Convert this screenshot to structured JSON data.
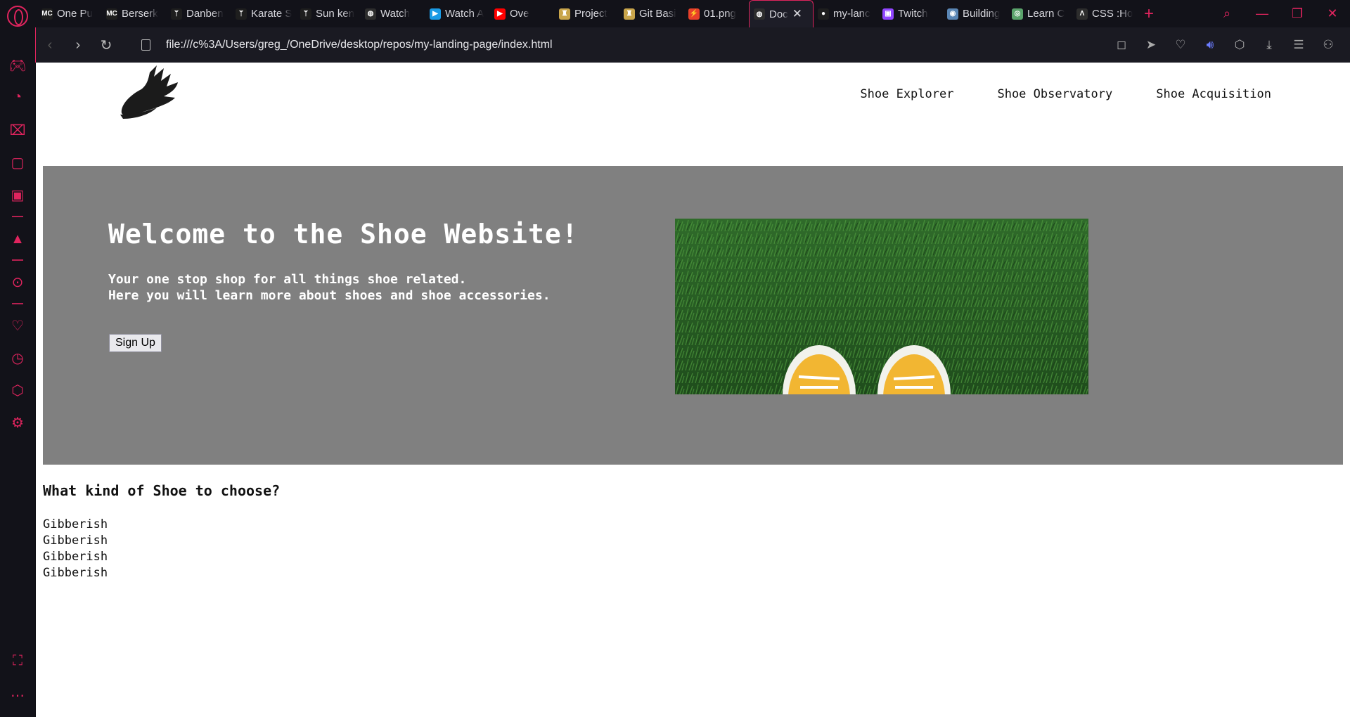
{
  "tabs": [
    {
      "title": "One Pu",
      "favicon": "mc-icon",
      "color": "#1e1e1e"
    },
    {
      "title": "Berserk",
      "favicon": "mc-icon",
      "color": "#1e1e1e"
    },
    {
      "title": "Danben",
      "favicon": "branch-icon",
      "color": "#1e1e1e"
    },
    {
      "title": "Karate S",
      "favicon": "branch-icon",
      "color": "#1e1e1e"
    },
    {
      "title": "Sun ken",
      "favicon": "branch-icon",
      "color": "#1e1e1e"
    },
    {
      "title": "Watch",
      "favicon": "globe-icon",
      "color": "#2d2d2d"
    },
    {
      "title": "Watch A",
      "favicon": "play-icon",
      "color": "#1a9be6"
    },
    {
      "title": "Ove",
      "favicon": "youtube-icon",
      "color": "#ff0000"
    },
    {
      "title": "Project",
      "favicon": "odin-icon",
      "color": "#c9a54b"
    },
    {
      "title": "Git Basi",
      "favicon": "odin-icon",
      "color": "#c9a54b"
    },
    {
      "title": "01.png",
      "favicon": "bolt-icon",
      "color": "#e8402a"
    },
    {
      "title": "Doc",
      "favicon": "globe-icon",
      "color": "#2d2d2d",
      "active": true
    },
    {
      "title": "my-lanc",
      "favicon": "github-icon",
      "color": "#1e1e1e"
    },
    {
      "title": "Twitch",
      "favicon": "twitch-icon",
      "color": "#9146ff"
    },
    {
      "title": "Building",
      "favicon": "planet-icon",
      "color": "#5a86b5"
    },
    {
      "title": "Learn C",
      "favicon": "freecodecamp-icon",
      "color": "#5aa36b"
    },
    {
      "title": "CSS :Ho",
      "favicon": "codepen-icon",
      "color": "#2d2d2d"
    }
  ],
  "address": {
    "url": "file:///c%3A/Users/greg_/OneDrive/desktop/repos/my-landing-page/index.html"
  },
  "site": {
    "nav": [
      "Shoe Explorer",
      "Shoe Observatory",
      "Shoe Acquisition"
    ],
    "hero": {
      "title": "Welcome to the Shoe Website!",
      "line1": "Your one stop shop for all things shoe related.",
      "line2": "Here you will learn more about shoes and shoe accessories.",
      "button": "Sign Up"
    },
    "section_title": "What kind of Shoe to choose?",
    "items": [
      "Gibberish",
      "Gibberish",
      "Gibberish",
      "Gibberish"
    ]
  },
  "colors": {
    "accent": "#e0245e",
    "hero_bg": "#808080"
  }
}
